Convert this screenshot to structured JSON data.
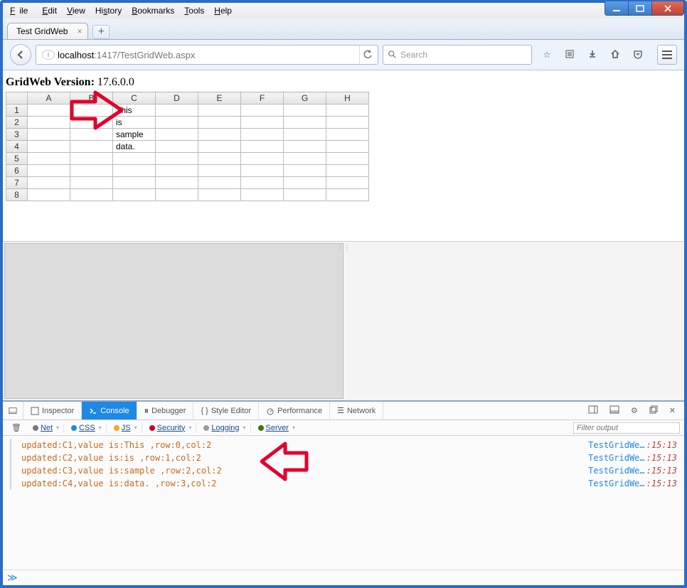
{
  "menu": {
    "file": "File",
    "edit": "Edit",
    "view": "View",
    "history": "History",
    "bookmarks": "Bookmarks",
    "tools": "Tools",
    "help": "Help"
  },
  "tab": {
    "title": "Test GridWeb"
  },
  "url": {
    "host": "localhost",
    "port": ":1417",
    "path": "/TestGridWeb.aspx"
  },
  "search": {
    "placeholder": "Search"
  },
  "page": {
    "version_label": "GridWeb Version:",
    "version_value": "17.6.0.0"
  },
  "grid": {
    "cols": [
      "A",
      "B",
      "C",
      "D",
      "E",
      "F",
      "G",
      "H"
    ],
    "rows": [
      "1",
      "2",
      "3",
      "4",
      "5",
      "6",
      "7",
      "8"
    ],
    "cells": {
      "C1": "This",
      "C2": "is",
      "C3": "sample",
      "C4": "data."
    }
  },
  "devtools": {
    "tabs": {
      "inspector": "Inspector",
      "console": "Console",
      "debugger": "Debugger",
      "styleeditor": "Style Editor",
      "performance": "Performance",
      "network": "Network"
    },
    "filters": {
      "net": "Net",
      "css": "CSS",
      "js": "JS",
      "security": "Security",
      "logging": "Logging",
      "server": "Server"
    },
    "filter_placeholder": "Filter output",
    "console_lines": [
      {
        "msg": "updated:C1,value is:This ,row:0,col:2",
        "src": "TestGridWe…",
        "time": ":15:13"
      },
      {
        "msg": "updated:C2,value is:is ,row:1,col:2",
        "src": "TestGridWe…",
        "time": ":15:13"
      },
      {
        "msg": "updated:C3,value is:sample ,row:2,col:2",
        "src": "TestGridWe…",
        "time": ":15:13"
      },
      {
        "msg": "updated:C4,value is:data. ,row:3,col:2",
        "src": "TestGridWe…",
        "time": ":15:13"
      }
    ]
  }
}
